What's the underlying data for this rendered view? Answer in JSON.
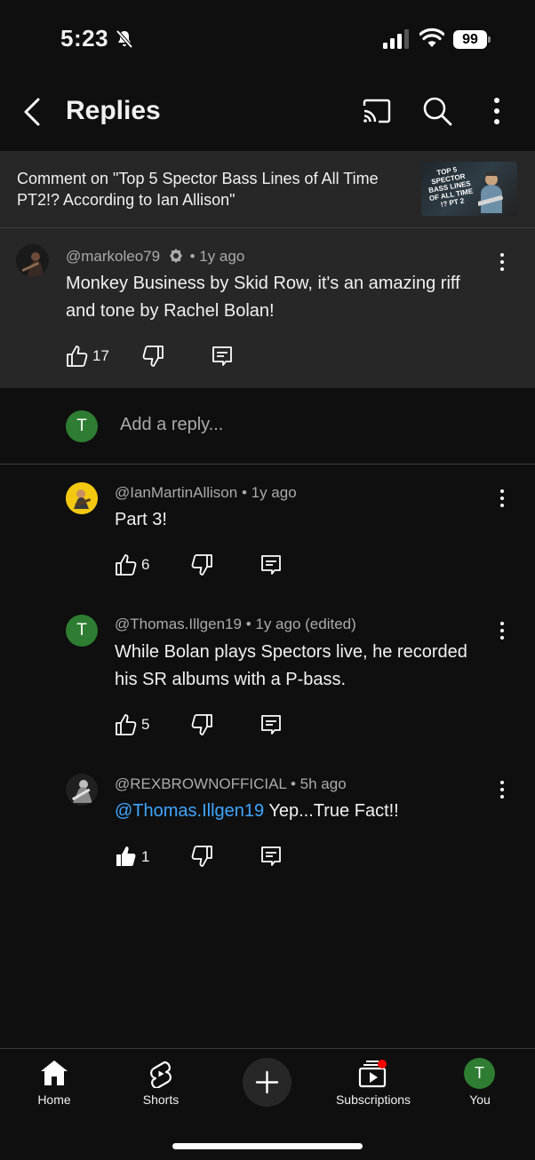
{
  "status_bar": {
    "time": "5:23",
    "battery": "99"
  },
  "header": {
    "title": "Replies"
  },
  "context": {
    "text": "Comment on \"Top 5 Spector Bass Lines of All Time PT2!? According to Ian Allison\"",
    "thumbnail_text": "TOP 5 SPECTOR BASS LINES OF ALL TIME !? PT 2"
  },
  "parent_comment": {
    "author": "@markoleo79",
    "time": "• 1y ago",
    "text": "Monkey Business by Skid Row, it's an amazing riff and tone by Rachel Bolan!",
    "likes": "17"
  },
  "reply_box": {
    "avatar_letter": "T",
    "placeholder": "Add a reply..."
  },
  "replies": [
    {
      "author": "@IanMartinAllison",
      "time": "• 1y ago",
      "text": "Part 3!",
      "likes": "6"
    },
    {
      "author": "@Thomas.Illgen19",
      "time": "• 1y ago (edited)",
      "avatar_letter": "T",
      "text": "While Bolan plays Spectors live, he recorded his SR albums with a P-bass.",
      "likes": "5"
    },
    {
      "author": "@REXBROWNOFFICIAL",
      "time": "• 5h ago",
      "mention": "@Thomas.Illgen19",
      "text": " Yep...True Fact!!",
      "likes": "1"
    }
  ],
  "bottom_nav": {
    "home": "Home",
    "shorts": "Shorts",
    "subscriptions": "Subscriptions",
    "you": "You",
    "you_letter": "T"
  },
  "colors": {
    "background": "#0f0f0f",
    "surface": "#272727",
    "avatar_green": "#2e7d32",
    "mention_blue": "#3ea6ff",
    "badge_red": "#ff0000"
  }
}
